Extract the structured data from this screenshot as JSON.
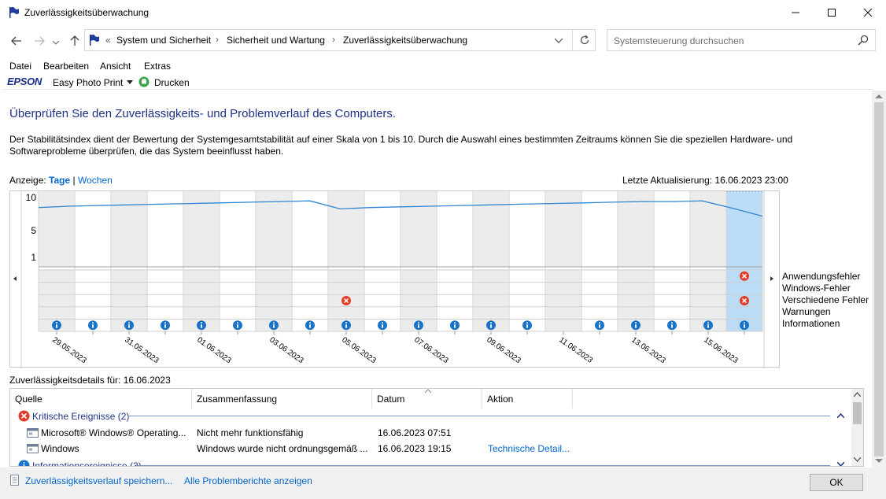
{
  "window": {
    "title": "Zuverlässigkeitsüberwachung"
  },
  "address": {
    "prefix": "«",
    "crumbs": [
      "System und Sicherheit",
      "Sicherheit und Wartung",
      "Zuverlässigkeitsüberwachung"
    ],
    "separator": "›"
  },
  "search": {
    "placeholder": "Systemsteuerung durchsuchen"
  },
  "menu": [
    "Datei",
    "Bearbeiten",
    "Ansicht",
    "Extras"
  ],
  "toolbar": {
    "brand": "EPSON",
    "easy_photo_print": "Easy Photo Print",
    "print": "Drucken"
  },
  "main": {
    "heading": "Überprüfen Sie den Zuverlässigkeits- und Problemverlauf des Computers.",
    "description": "Der Stabilitätsindex dient der Bewertung der Systemgesamtstabilität auf einer Skala von 1 bis 10. Durch die Auswahl eines bestimmten Zeitraums können Sie die speziellen Hardware- und Softwareprobleme überprüfen, die das System beeinflusst haben.",
    "view_prefix": "Anzeige:",
    "view_days": "Tage",
    "view_sep": "|",
    "view_weeks": "Wochen",
    "last_update": "Letzte Aktualisierung: 16.06.2023 23:00"
  },
  "chart_data": {
    "type": "line",
    "y_ticks": [
      "10",
      "5",
      "1"
    ],
    "ylim": [
      1,
      10
    ],
    "stability": [
      8.5,
      8.7,
      8.8,
      8.9,
      9.0,
      9.1,
      9.2,
      9.3,
      9.4,
      9.5,
      8.3,
      8.5,
      8.6,
      8.7,
      8.8,
      8.9,
      9.0,
      9.1,
      9.2,
      9.3,
      9.4,
      9.4,
      9.5,
      8.4,
      7.2
    ],
    "date_labels": [
      "29.05.2023",
      "31.05.2023",
      "01.06.2023",
      "03.06.2023",
      "05.06.2023",
      "07.06.2023",
      "09.06.2023",
      "11.06.2023",
      "13.06.2023",
      "15.06.2023"
    ],
    "legend": [
      "Anwendungsfehler",
      "Windows-Fehler",
      "Verschiedene Fehler",
      "Warnungen",
      "Informationen"
    ],
    "selected_column": 19,
    "column_count": 20,
    "app_errors": [
      19
    ],
    "misc_errors": [
      8,
      19
    ],
    "info_events": [
      0,
      1,
      2,
      3,
      4,
      5,
      6,
      7,
      8,
      9,
      10,
      11,
      12,
      13,
      15,
      16,
      17,
      18,
      19
    ]
  },
  "details": {
    "label": "Zuverlässigkeitsdetails für: 16.06.2023",
    "columns": [
      "Quelle",
      "Zusammenfassung",
      "Datum",
      "Aktion"
    ],
    "groups": [
      {
        "title": "Kritische Ereignisse (2)",
        "rows": [
          {
            "source": "Microsoft® Windows® Operating...",
            "summary": "Nicht mehr funktionsfähig",
            "date": "16.06.2023 07:51",
            "action": ""
          },
          {
            "source": "Windows",
            "summary": "Windows wurde nicht ordnungsgemäß ...",
            "date": "16.06.2023 19:15",
            "action": "Technische Detail..."
          }
        ]
      },
      {
        "title": "Informationsereignisse (3)",
        "rows": []
      }
    ]
  },
  "footer": {
    "save_link": "Zuverlässigkeitsverlauf speichern...",
    "all_reports_link": "Alle Problemberichte anzeigen",
    "ok": "OK"
  },
  "colors": {
    "accent_link": "#0066cc",
    "heading": "#1e3287",
    "chart_line": "#2f86d1",
    "selection": "#bcdcf5",
    "error": "#e23b2a",
    "info": "#1a73c9"
  }
}
